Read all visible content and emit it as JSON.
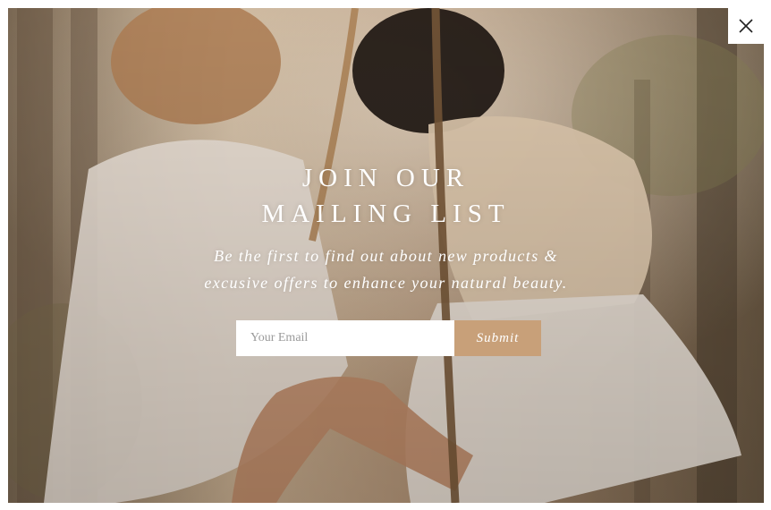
{
  "popup": {
    "title_line1": "JOIN OUR",
    "title_line2": "MAILING LIST",
    "subtitle_line1": "Be the first to find out about new products &",
    "subtitle_line2": "excusive offers to enhance your natural beauty.",
    "email_placeholder": "Your Email",
    "submit_label": "Submit",
    "close_icon": "close-icon"
  },
  "colors": {
    "submit_button": "#c8a079",
    "text": "#ffffff",
    "close_background": "#ffffff"
  }
}
